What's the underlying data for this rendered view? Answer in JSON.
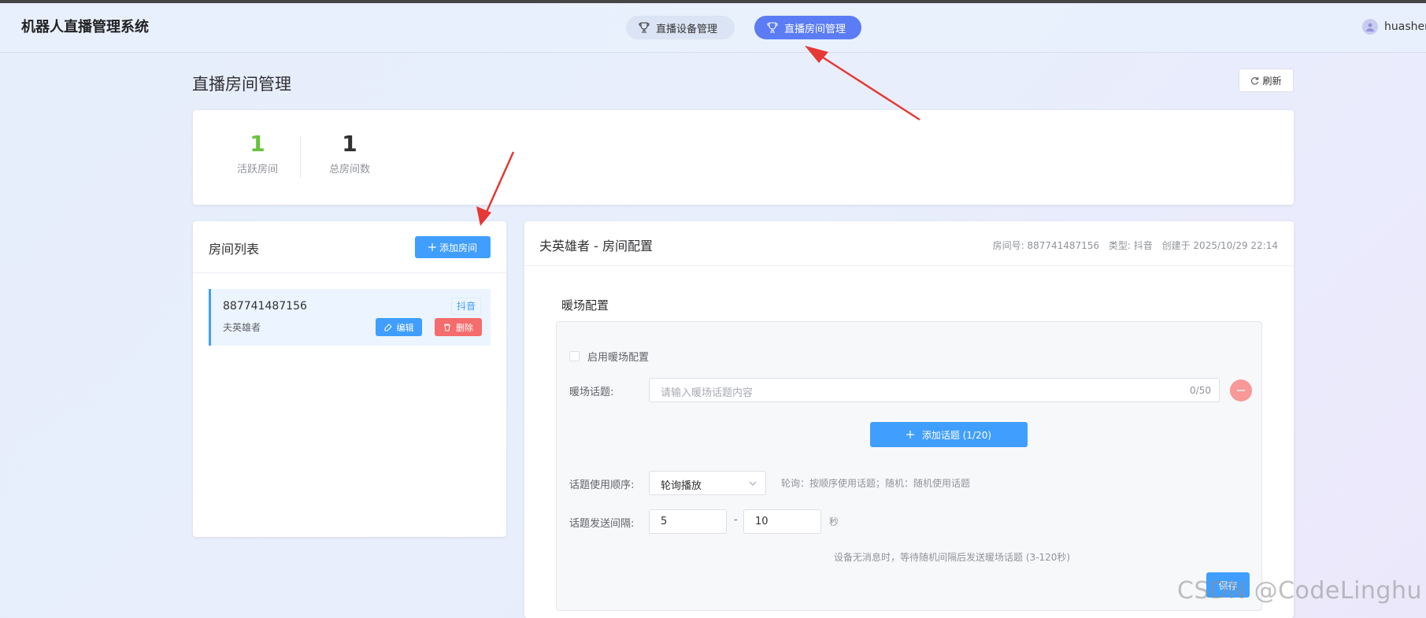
{
  "header": {
    "app_title": "机器人直播管理系统",
    "nav": [
      {
        "label": "直播设备管理",
        "icon": "trophy-icon",
        "active": false
      },
      {
        "label": "直播房间管理",
        "icon": "trophy-icon",
        "active": true
      }
    ],
    "user": {
      "name": "huashen",
      "icon": "user-avatar-icon"
    }
  },
  "page": {
    "title": "直播房间管理",
    "refresh_label": "刷新"
  },
  "stats": [
    {
      "value": "1",
      "label": "活跃房间",
      "color": "#67c23a"
    },
    {
      "value": "1",
      "label": "总房间数",
      "color": "#303133"
    }
  ],
  "room_list": {
    "title": "房间列表",
    "add_button": "添加房间",
    "items": [
      {
        "room_id": "887741487156",
        "name": "夫英雄者",
        "platform": "抖音",
        "edit_label": "编辑",
        "delete_label": "删除"
      }
    ]
  },
  "config": {
    "title": "夫英雄者 - 房间配置",
    "room_no": "房间号: 887741487156",
    "type": "类型: 抖音",
    "created": "创建于 2025/10/29 22:14",
    "section_title": "暖场配置",
    "enable_label": "启用暖场配置",
    "enable_checked": false,
    "topic_label": "暖场话题:",
    "topic_placeholder": "请输入暖场话题内容",
    "topic_count": "0/50",
    "add_topic_button": "添加话题 (1/20)",
    "order_label": "话题使用顺序:",
    "order_value": "轮询播放",
    "order_hint": "轮询：按顺序使用话题；随机：随机使用话题",
    "interval_label": "话题发送间隔:",
    "interval_min": "5",
    "interval_separator": "-",
    "interval_max": "10",
    "interval_unit": "秒",
    "interval_hint": "设备无消息时，等待随机间隔后发送暖场话题 (3-120秒)",
    "save_label": "保存"
  },
  "watermark": "CSDN @CodeLinghu",
  "colors": {
    "primary": "#409eff",
    "nav_active": "#5b7cf5",
    "danger": "#f56c6c",
    "success": "#67c23a",
    "annotation_arrow": "#e53935"
  }
}
